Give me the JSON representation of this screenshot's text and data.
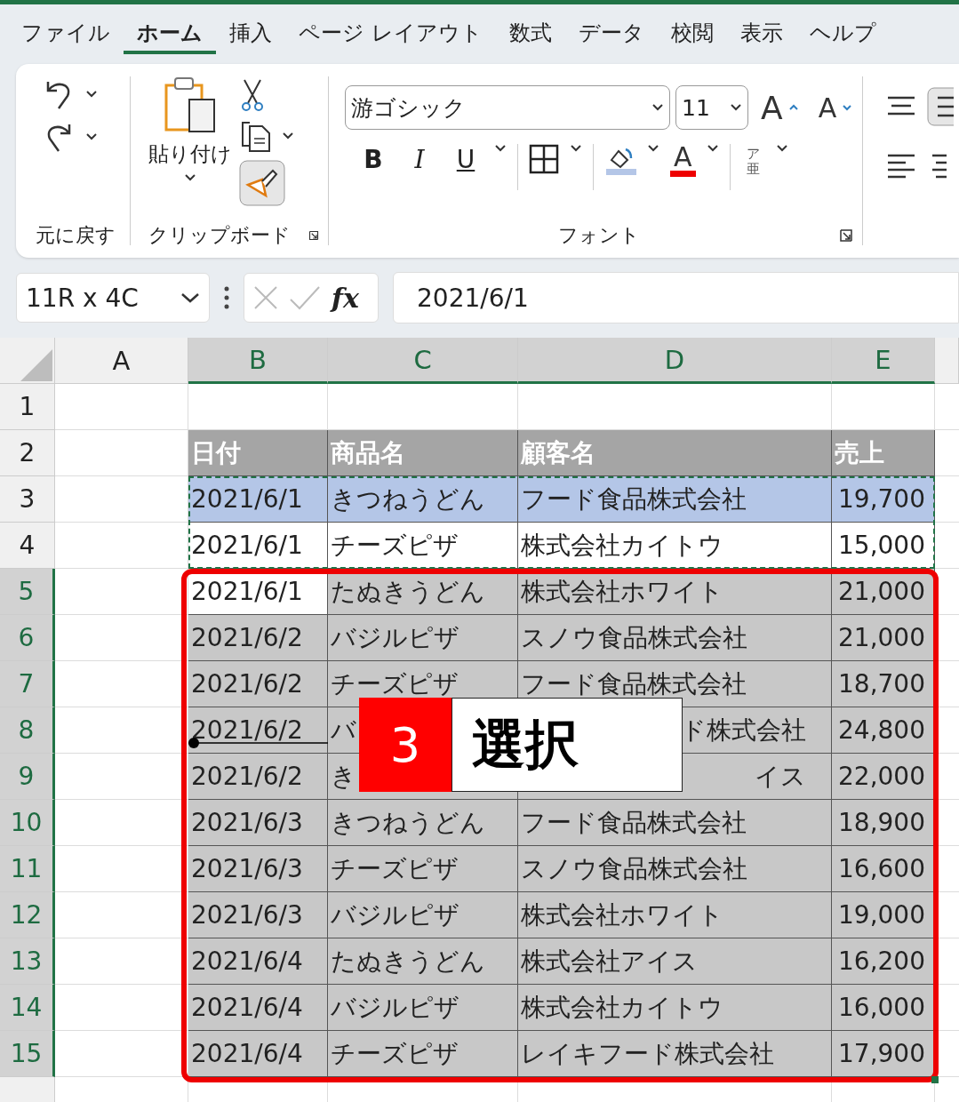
{
  "menu_tabs": [
    {
      "label": "ファイル",
      "selected": false
    },
    {
      "label": "ホーム",
      "selected": true
    },
    {
      "label": "挿入",
      "selected": false
    },
    {
      "label": "ページ レイアウト",
      "selected": false
    },
    {
      "label": "数式",
      "selected": false
    },
    {
      "label": "データ",
      "selected": false
    },
    {
      "label": "校閲",
      "selected": false
    },
    {
      "label": "表示",
      "selected": false
    },
    {
      "label": "ヘルプ",
      "selected": false
    }
  ],
  "ribbon": {
    "undo_group": "元に戻す",
    "paste_label": "貼り付け",
    "clipboard_group": "クリップボード",
    "font_name": "游ゴシック",
    "font_size": "11",
    "grow_label": "A",
    "shrink_label": "A",
    "format_buttons": [
      "B",
      "I",
      "U"
    ],
    "font_color_label": "A",
    "phonetic": [
      "ア",
      "亜"
    ],
    "font_group": "フォント"
  },
  "formula_bar": {
    "name_box": "11R x 4C",
    "fx": "fx",
    "value": "2021/6/1"
  },
  "sheet": {
    "columns": [
      {
        "label": "A",
        "selected": false
      },
      {
        "label": "B",
        "selected": true
      },
      {
        "label": "C",
        "selected": true
      },
      {
        "label": "D",
        "selected": true
      },
      {
        "label": "E",
        "selected": true
      }
    ],
    "rows": [
      {
        "number": "1",
        "kind": "blank",
        "selected": false
      },
      {
        "number": "2",
        "kind": "header",
        "selected": false,
        "cells": [
          "日付",
          "商品名",
          "顧客名",
          "売上"
        ]
      },
      {
        "number": "3",
        "kind": "highlight",
        "selected": false,
        "cells": [
          "2021/6/1",
          "きつねうどん",
          "フード食品株式会社",
          "19,700"
        ]
      },
      {
        "number": "4",
        "kind": "data",
        "selected": false,
        "cells": [
          "2021/6/1",
          "チーズピザ",
          "株式会社カイトウ",
          "15,000"
        ]
      },
      {
        "number": "5",
        "kind": "data",
        "selected": true,
        "cells": [
          "2021/6/1",
          "たぬきうどん",
          "株式会社ホワイト",
          "21,000"
        ]
      },
      {
        "number": "6",
        "kind": "data",
        "selected": true,
        "cells": [
          "2021/6/2",
          "バジルピザ",
          "スノウ食品株式会社",
          "21,000"
        ]
      },
      {
        "number": "7",
        "kind": "data",
        "selected": true,
        "cells": [
          "2021/6/2",
          "チーズピザ",
          "フード食品株式会社",
          "18,700"
        ]
      },
      {
        "number": "8",
        "kind": "partial",
        "selected": true,
        "cells": [
          "2021/6/2",
          "バ",
          "ド株式会社",
          "24,800"
        ]
      },
      {
        "number": "9",
        "kind": "partial",
        "selected": true,
        "cells": [
          "2021/6/2",
          "き",
          "イス",
          "22,000"
        ]
      },
      {
        "number": "10",
        "kind": "data",
        "selected": true,
        "cells": [
          "2021/6/3",
          "きつねうどん",
          "フード食品株式会社",
          "18,900"
        ]
      },
      {
        "number": "11",
        "kind": "data",
        "selected": true,
        "cells": [
          "2021/6/3",
          "チーズピザ",
          "スノウ食品株式会社",
          "16,600"
        ]
      },
      {
        "number": "12",
        "kind": "data",
        "selected": true,
        "cells": [
          "2021/6/3",
          "バジルピザ",
          "株式会社ホワイト",
          "19,000"
        ]
      },
      {
        "number": "13",
        "kind": "data",
        "selected": true,
        "cells": [
          "2021/6/4",
          "たぬきうどん",
          "株式会社アイス",
          "16,200"
        ]
      },
      {
        "number": "14",
        "kind": "data",
        "selected": true,
        "cells": [
          "2021/6/4",
          "バジルピザ",
          "株式会社カイトウ",
          "16,000"
        ]
      },
      {
        "number": "15",
        "kind": "data",
        "selected": true,
        "cells": [
          "2021/6/4",
          "チーズピザ",
          "レイキフード株式会社",
          "17,900"
        ]
      },
      {
        "kind": "blank",
        "selected": false
      }
    ]
  },
  "callout": {
    "step": "3",
    "label": "選択"
  }
}
